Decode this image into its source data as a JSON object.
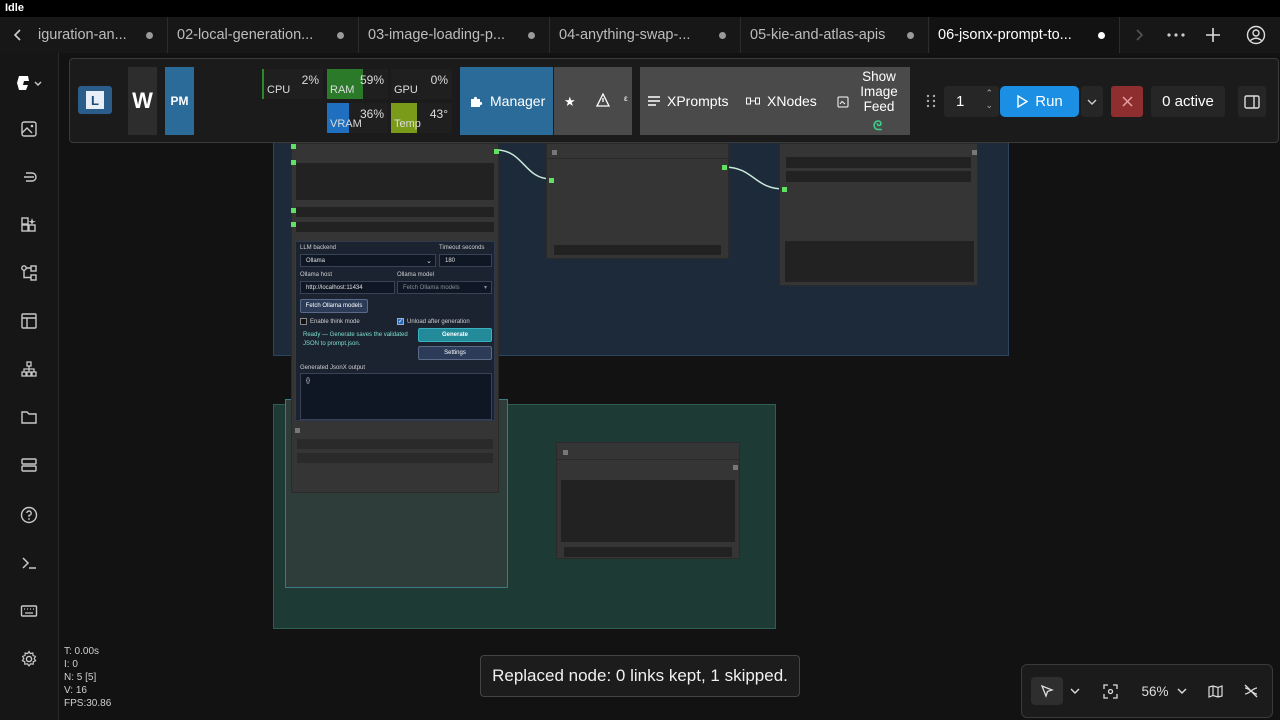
{
  "window": {
    "title": "Idle"
  },
  "tabs": [
    {
      "label": "iguration-an...",
      "active": false
    },
    {
      "label": "02-local-generation...",
      "active": false
    },
    {
      "label": "03-image-loading-p...",
      "active": false
    },
    {
      "label": "04-anything-swap-...",
      "active": false
    },
    {
      "label": "05-kie-and-atlas-apis",
      "active": false
    },
    {
      "label": "06-jsonx-prompt-to...",
      "active": true
    }
  ],
  "tab_icons": {
    "prev": "chevron-left-icon",
    "next": "chevron-right-icon",
    "more": "more-horizontal-icon",
    "add": "plus-icon",
    "user": "user-icon"
  },
  "sidebar": {
    "logo": "comfy-logo-icon",
    "items": [
      "images-icon",
      "models-icon",
      "nodes-icon",
      "workflows-icon",
      "templates-icon",
      "node-library-icon",
      "folder-icon",
      "queue-icon",
      "help-icon",
      "terminal-icon",
      "keyboard-icon",
      "settings-icon"
    ]
  },
  "toolbar": {
    "badges": {
      "l": "L",
      "w": "W",
      "pm": "PM"
    },
    "monitor": {
      "cpu": {
        "label": "CPU",
        "value": "2%",
        "level": 0.02
      },
      "ram": {
        "label": "RAM",
        "value": "59%",
        "level": 0.59,
        "color": "#2a7a2a"
      },
      "gpu": {
        "label": "GPU",
        "value": "0%",
        "level": 0.0
      },
      "vram": {
        "label": "VRAM",
        "value": "36%",
        "level": 0.36,
        "color": "#1e6fbf"
      },
      "temp": {
        "label": "Temp",
        "value": "43°",
        "level": 0.43,
        "color": "#7a9a1a"
      }
    },
    "manager_label": "Manager",
    "xprompts_label": "XPrompts",
    "xnodes_label": "XNodes",
    "image_feed": {
      "line1": "Show",
      "line2": "Image",
      "line3": "Feed"
    },
    "batch_count": "1",
    "run_label": "Run",
    "active_label": "0 active",
    "accent": "#1a8fe3",
    "cancel_color": "#8e2e2e"
  },
  "panel": {
    "llm_backend_label": "LLM backend",
    "llm_backend_value": "Ollama",
    "timeout_label": "Timeout seconds",
    "timeout_value": "180",
    "ollama_host_label": "Ollama host",
    "ollama_host_value": "http://localhost:11434",
    "ollama_model_label": "Ollama model",
    "ollama_model_placeholder": "Fetch Ollama models",
    "fetch_button": "Fetch Ollama models",
    "think_label": "Enable think mode",
    "think_checked": false,
    "unload_label": "Unload after generation",
    "unload_checked": true,
    "status_text": "Ready — Generate saves the validated JSON to prompt.json.",
    "generate_button": "Generate",
    "settings_button": "Settings",
    "output_label": "Generated JsonX output",
    "output_value": "{}"
  },
  "stats": {
    "t": "T: 0.00s",
    "i": "I: 0",
    "n": "N: 5 [5]",
    "v": "V: 16",
    "fps": "FPS:30.86"
  },
  "toast": "Replaced node: 0 links kept, 1 skipped.",
  "zoom": {
    "value": "56%"
  }
}
